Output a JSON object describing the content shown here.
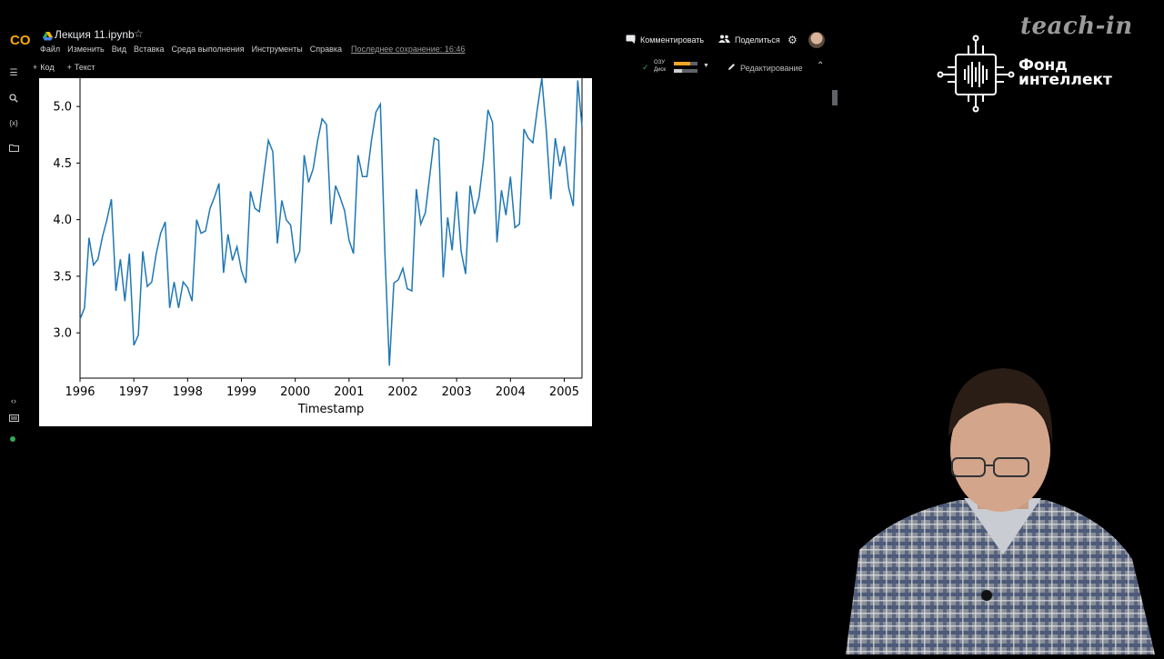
{
  "app": {
    "notebook_title": "Лекция 11.ipynb",
    "menu": [
      "Файл",
      "Изменить",
      "Вид",
      "Вставка",
      "Среда выполнения",
      "Инструменты",
      "Справка"
    ],
    "last_save": "Последнее сохранение: 16:46",
    "toolbar": {
      "add_code": "Код",
      "add_text": "Текст"
    },
    "header": {
      "comment_label": "Комментировать",
      "share_label": "Поделиться",
      "ram_label": "ОЗУ",
      "disk_label": "Диск",
      "ram_fraction": 0.7,
      "disk_fraction": 0.35,
      "editing_label": "Редактирование"
    },
    "colors": {
      "accent_ok": "#34a853",
      "ram_bar": "#f5a623",
      "logo_orange": "#f9ab00"
    }
  },
  "branding": {
    "watermark": "teach-in",
    "fund_line1": "Фонд",
    "fund_line2": "интеллект"
  },
  "chart_data": {
    "type": "line",
    "xlabel": "Timestamp",
    "ylabel": "",
    "x_ticks": [
      "1996",
      "1997",
      "1998",
      "1999",
      "2000",
      "2001",
      "2002",
      "2003",
      "2004",
      "2005"
    ],
    "y_ticks": [
      "3.0",
      "3.5",
      "4.0",
      "4.5",
      "5.0"
    ],
    "xlim": [
      1996.0,
      2005.33
    ],
    "ylim": [
      2.6,
      5.25
    ],
    "line_color": "#1f77b4",
    "x": [
      1996.0,
      1996.083,
      1996.167,
      1996.25,
      1996.333,
      1996.417,
      1996.5,
      1996.583,
      1996.667,
      1996.75,
      1996.833,
      1996.917,
      1997.0,
      1997.083,
      1997.167,
      1997.25,
      1997.333,
      1997.417,
      1997.5,
      1997.583,
      1997.667,
      1997.75,
      1997.833,
      1997.917,
      1998.0,
      1998.083,
      1998.167,
      1998.25,
      1998.333,
      1998.417,
      1998.5,
      1998.583,
      1998.667,
      1998.75,
      1998.833,
      1998.917,
      1999.0,
      1999.083,
      1999.167,
      1999.25,
      1999.333,
      1999.417,
      1999.5,
      1999.583,
      1999.667,
      1999.75,
      1999.833,
      1999.917,
      2000.0,
      2000.083,
      2000.167,
      2000.25,
      2000.333,
      2000.417,
      2000.5,
      2000.583,
      2000.667,
      2000.75,
      2000.833,
      2000.917,
      2001.0,
      2001.083,
      2001.167,
      2001.25,
      2001.333,
      2001.417,
      2001.5,
      2001.583,
      2001.667,
      2001.75,
      2001.833,
      2001.917,
      2002.0,
      2002.083,
      2002.167,
      2002.25,
      2002.333,
      2002.417,
      2002.5,
      2002.583,
      2002.667,
      2002.75,
      2002.833,
      2002.917,
      2003.0,
      2003.083,
      2003.167,
      2003.25,
      2003.333,
      2003.417,
      2003.5,
      2003.583,
      2003.667,
      2003.75,
      2003.833,
      2003.917,
      2004.0,
      2004.083,
      2004.167,
      2004.25,
      2004.333,
      2004.417,
      2004.5,
      2004.583,
      2004.667,
      2004.75,
      2004.833,
      2004.917,
      2005.0,
      2005.083,
      2005.167,
      2005.25,
      2005.33
    ],
    "y": [
      3.12,
      3.22,
      3.84,
      3.6,
      3.65,
      3.85,
      4.0,
      4.18,
      3.37,
      3.65,
      3.28,
      3.7,
      2.89,
      2.98,
      3.72,
      3.41,
      3.45,
      3.7,
      3.88,
      3.98,
      3.22,
      3.45,
      3.22,
      3.45,
      3.4,
      3.28,
      4.0,
      3.88,
      3.9,
      4.1,
      4.2,
      4.32,
      3.53,
      3.87,
      3.64,
      3.76,
      3.55,
      3.44,
      4.25,
      4.1,
      4.07,
      4.4,
      4.7,
      4.6,
      3.79,
      4.17,
      4.0,
      3.95,
      3.63,
      3.72,
      4.57,
      4.33,
      4.45,
      4.7,
      4.89,
      4.84,
      3.96,
      4.3,
      4.2,
      4.08,
      3.82,
      3.7,
      4.57,
      4.38,
      4.38,
      4.7,
      4.95,
      5.02,
      3.7,
      2.71,
      3.44,
      3.47,
      3.57,
      3.39,
      3.37,
      4.27,
      3.96,
      4.06,
      4.39,
      4.72,
      4.7,
      3.49,
      4.02,
      3.73,
      4.25,
      3.72,
      3.52,
      4.3,
      4.05,
      4.2,
      4.53,
      4.97,
      4.86,
      3.8,
      4.26,
      4.04,
      4.38,
      3.93,
      3.96,
      4.8,
      4.72,
      4.68,
      4.98,
      5.25,
      4.78,
      4.18,
      4.72,
      4.47,
      4.65,
      4.28,
      4.12,
      5.23,
      4.82,
      5.0
    ]
  }
}
